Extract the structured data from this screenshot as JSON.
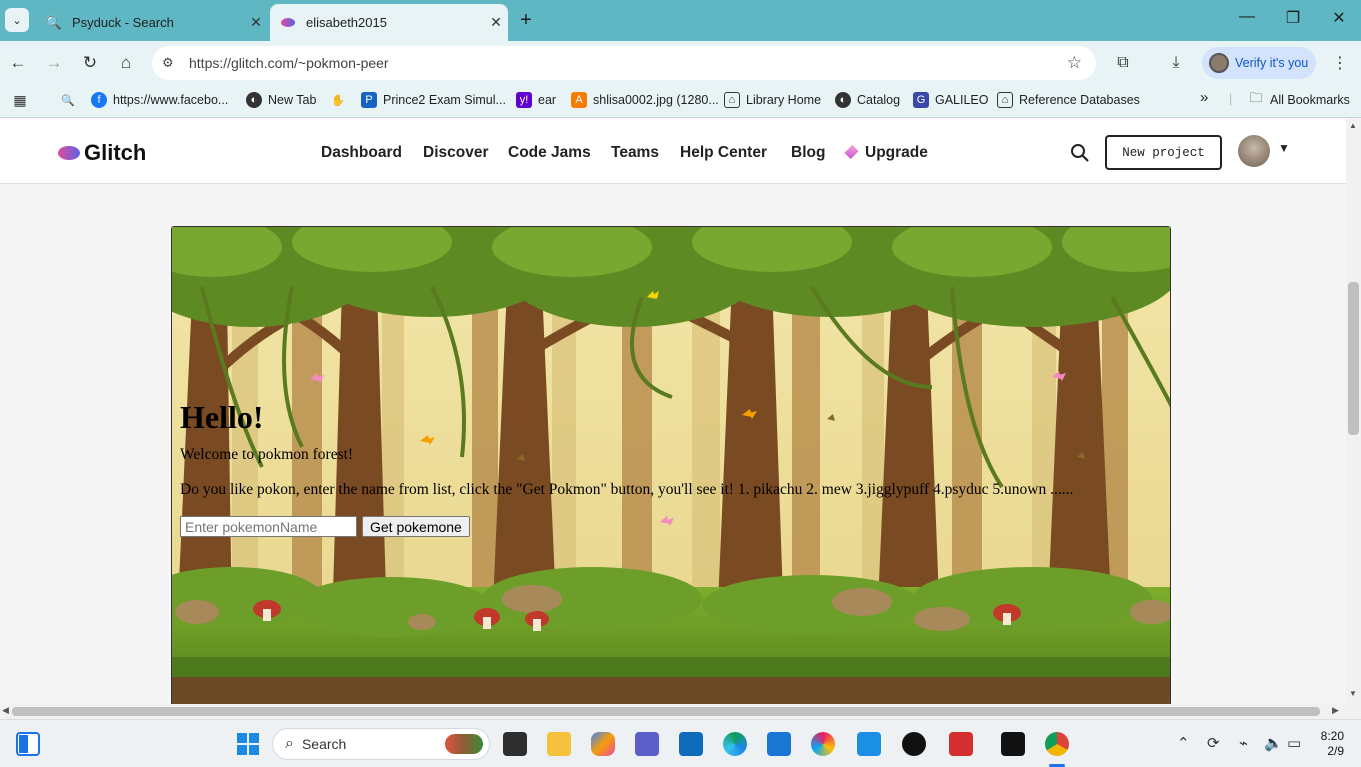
{
  "browser": {
    "tabs": [
      {
        "title": "Psyduck - Search",
        "icon": "search-icon"
      },
      {
        "title": "elisabeth2015",
        "icon": "glitch-icon"
      }
    ],
    "url": "https://glitch.com/~pokmon-peer",
    "verify_label": "Verify it's you",
    "bookmarks": [
      {
        "label": "https://www.facebo...",
        "icon": "facebook-icon"
      },
      {
        "label": "New Tab",
        "icon": "globe-icon"
      },
      {
        "label": "Prince2 Exam Simul...",
        "icon": "prince-icon"
      },
      {
        "label": "ear",
        "icon": "yahoo-icon"
      },
      {
        "label": "shlisa0002.jpg (1280...",
        "icon": "image-icon"
      },
      {
        "label": "Library Home",
        "icon": "library-icon"
      },
      {
        "label": "Catalog",
        "icon": "globe-icon"
      },
      {
        "label": "GALILEO",
        "icon": "galileo-icon"
      },
      {
        "label": "Reference Databases",
        "icon": "library-icon"
      }
    ],
    "all_bookmarks": "All Bookmarks",
    "overflow": "»"
  },
  "glitch": {
    "logo": "Glitch",
    "nav": [
      "Dashboard",
      "Discover",
      "Code Jams",
      "Teams",
      "Help Center",
      "Blog",
      "Upgrade"
    ],
    "new_project": "New project"
  },
  "app": {
    "heading": "Hello!",
    "welcome": "Welcome to pokmon forest!",
    "instructions": "Do you like pokon, enter the name from list, click the \"Get Pokmon\" button, you'll see it! 1. pikachu 2. mew 3.jigglypuff 4.psyduc 5.unown ......",
    "input_placeholder": "Enter pokemonName",
    "button_label": "Get pokemone"
  },
  "taskbar": {
    "search_label": "Search",
    "time": "8:20",
    "date": "2/9"
  },
  "colors": {
    "tabbar": "#5fb7c3",
    "toolbar": "#e8f3f5",
    "accent": "#0b57d0"
  }
}
